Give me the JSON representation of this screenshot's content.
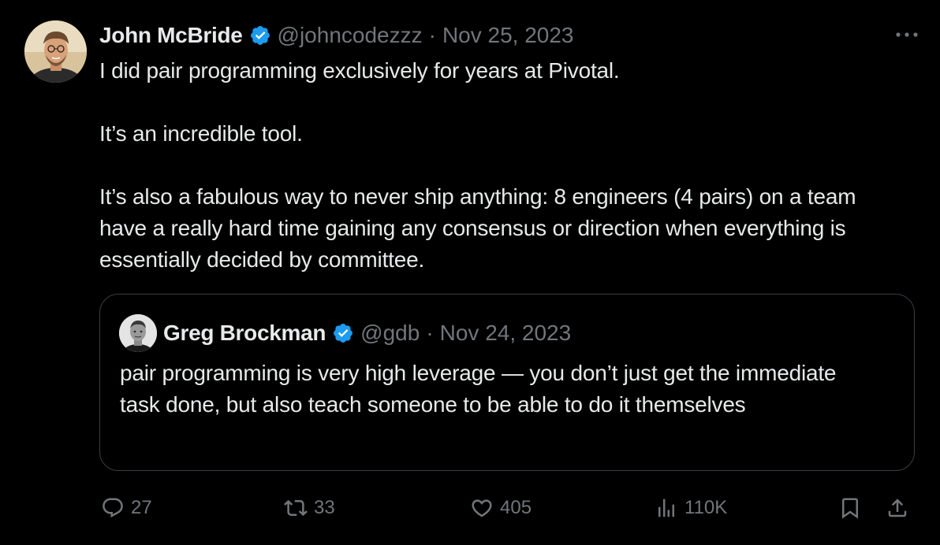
{
  "tweet": {
    "author_name": "John McBride",
    "author_handle": "@johncodezzz",
    "separator": "·",
    "date": "Nov 25, 2023",
    "paragraphs": [
      "I did pair programming exclusively for years at Pivotal.",
      "It’s an incredible tool.",
      "It’s also a fabulous way to never ship anything: 8 engineers (4 pairs) on a team have a really hard time gaining any consensus or direction when everything is essentially decided by committee."
    ],
    "verified": true,
    "more_icon": "more-horizontal-icon"
  },
  "quoted": {
    "author_name": "Greg Brockman",
    "author_handle": "@gdb",
    "separator": "·",
    "date": "Nov 24, 2023",
    "text": "pair programming is very high leverage — you don’t just get the immediate task done, but also teach someone to be able to do it themselves",
    "verified": true
  },
  "actions": {
    "replies": "27",
    "reposts": "33",
    "likes": "405",
    "views": "110K",
    "icons": [
      "reply-icon",
      "repost-icon",
      "like-icon",
      "views-icon",
      "bookmark-icon",
      "share-icon"
    ]
  },
  "colors": {
    "background": "#000000",
    "text": "#e7e9ea",
    "muted": "#71767b",
    "verified": "#1d9bf0",
    "border": "#3a3d42"
  }
}
